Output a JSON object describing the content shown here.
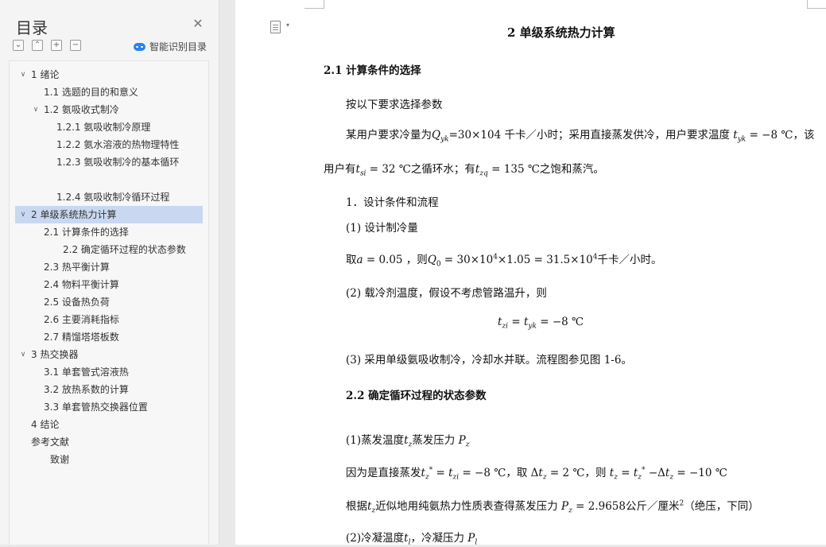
{
  "toc": {
    "title": "目录",
    "smart_toc_label": "智能识别目录",
    "items": [
      {
        "label": "1 绪论",
        "expanded": true
      },
      {
        "label": "1.1 选题的目的和意义"
      },
      {
        "label": "1.2 氨吸收式制冷",
        "expanded": true
      },
      {
        "label": "1.2.1 氨吸收制冷原理"
      },
      {
        "label": "1.2.2 氨水溶液的热物理特性"
      },
      {
        "label": "1.2.3 氨吸收制冷的基本循环"
      },
      {
        "label": "1.2.4 氨吸收制冷循环过程"
      },
      {
        "label": "2 单级系统热力计算",
        "expanded": true,
        "selected": true
      },
      {
        "label": "2.1 计算条件的选择"
      },
      {
        "label": "2.2 确定循环过程的状态参数"
      },
      {
        "label": "2.3 热平衡计算"
      },
      {
        "label": "2.4 物料平衡计算"
      },
      {
        "label": "2.5 设备热负荷"
      },
      {
        "label": "2.6 主要消耗指标"
      },
      {
        "label": "2.7 精馏塔塔板数"
      },
      {
        "label": "3 热交换器",
        "expanded": true
      },
      {
        "label": "3.1 单套管式溶液热"
      },
      {
        "label": "3.2 放热系数的计算"
      },
      {
        "label": "3.3 单套管热交换器位置"
      },
      {
        "label": "4 结论"
      },
      {
        "label": "参考文献"
      },
      {
        "label": "致谢"
      }
    ]
  },
  "doc": {
    "heading_main": "2 单级系统热力计算",
    "h21": "2.1 计算条件的选择",
    "p_select": "按以下要求选择参数",
    "p_user_a": "某用户要求冷量为",
    "p_user_b": "=30×104 千卡／小时；采用直接蒸发供冷，用户要求温度",
    "p_user_c": "= −8 ℃，该",
    "p_user2_a": "用户有",
    "p_user2_b": "= 32 ℃之循环水；有",
    "p_user2_c": "= 135 ℃之饱和蒸汽。",
    "p_design": "1．设计条件和流程",
    "p_design1": "(1) 设计制冷量",
    "p_q0_a": "取",
    "p_q0_b": "a",
    "p_q0_c": "= 0.05 ，则",
    "p_q0_d": "= 30×10",
    "p_q0_e": "×1.05 = 31.5×10",
    "p_q0_f": "千卡／小时。",
    "p_design2": "(2) 载冷剂温度，假设不考虑管路温升，则",
    "p_eq": "= −8 ℃",
    "p_design3": "(3) 采用单级氨吸收制冷，冷却水并联。流程图参见图 1-6。",
    "h22": "2.2 确定循环过程的状态参数",
    "p_evap": "(1)蒸发温度",
    "p_evap_b": "蒸发压力",
    "p_because_a": "因为是直接蒸发",
    "p_because_b": "= −8 ℃，取 Δ",
    "p_because_c": "= 2 ℃，则",
    "p_because_d": "−Δ",
    "p_because_e": "= −10 ℃",
    "p_base_a": "根据",
    "p_base_b": "近似地用纯氨热力性质表查得蒸发压力",
    "p_base_c": "= 2.9658公斤／厘米",
    "p_base_d": "（绝压，下同）",
    "p_cond": "(2)冷凝温度",
    "p_cond_b": "，冷凝压力"
  }
}
